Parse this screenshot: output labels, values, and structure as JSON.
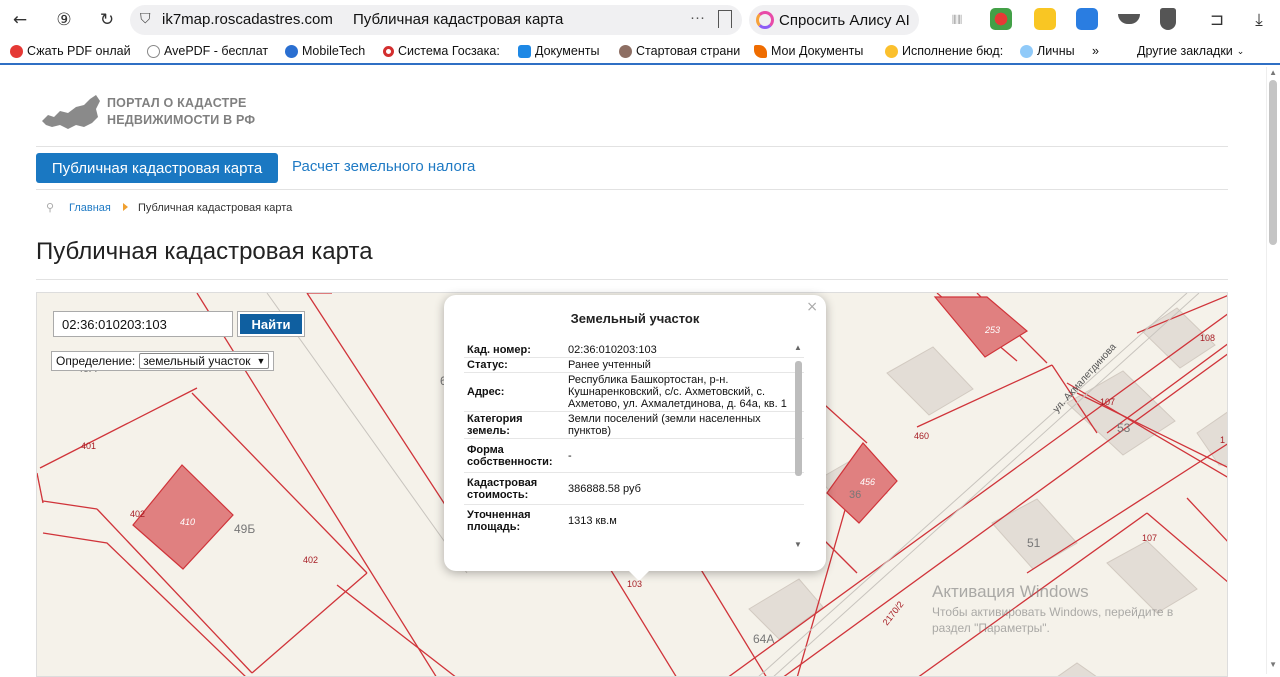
{
  "browser": {
    "url_domain": "ik7map.roscadastres.com",
    "tab_title": "Публичная кадастровая карта",
    "alice_label": "Спросить Алису AI",
    "bookmarks": [
      "Сжать PDF онлай",
      "AvePDF - бесплат",
      "MobileTech",
      "Система Госзака:",
      "Документы",
      "Стартовая страни",
      "Мои Документы",
      "Исполнение бюд:",
      "Личны",
      "»",
      "Другие закладки"
    ]
  },
  "site": {
    "logo_line1": "ПОРТАЛ О КАДАСТРЕ",
    "logo_line2": "НЕДВИЖИМОСТИ В РФ",
    "nav_active": "Публичная кадастровая карта",
    "nav_link": "Расчет земельного налога",
    "breadcrumb_home": "Главная",
    "breadcrumb_current": "Публичная кадастровая карта",
    "page_title": "Публичная кадастровая карта"
  },
  "map": {
    "search_value": "02:36:010203:103",
    "search_button": "Найти",
    "definition_label": "Определение:",
    "definition_value": "земельный участок",
    "labels": {
      "l401": "401",
      "l402a": "402",
      "l410": "410",
      "l49b": "49Б",
      "l402b": "402",
      "l49a": "49А",
      "l253": "253",
      "l108": "108",
      "l107a": "107",
      "l53": "53",
      "l460": "460",
      "l456": "456",
      "l51": "51",
      "l107b": "107",
      "l103": "103",
      "l64a": "64А",
      "l2170": "2170/2",
      "street": "ул. Ахмалетдинова",
      "l1": "1",
      "l6": "6",
      "l36": "36"
    },
    "colors": {
      "background": "#f5f2ea",
      "parcel_line": "#d0343a",
      "parcel_fill": "#e08080",
      "building": "#e3ddd6"
    }
  },
  "popup": {
    "title": "Земельный участок",
    "close": "×",
    "rows": [
      {
        "key": "Кад. номер:",
        "value": "02:36:010203:103"
      },
      {
        "key": "Статус:",
        "value": "Ранее учтенный"
      },
      {
        "key": "Адрес:",
        "value": "Республика Башкортостан, р-н. Кушнаренковский, с/с. Ахметовский, с. Ахметово, ул. Ахмалетдинова, д. 64а, кв. 1"
      },
      {
        "key": "Категория земель:",
        "value": "Земли поселений (земли населенных пунктов)"
      },
      {
        "key": "Форма собственности:",
        "value": "-"
      },
      {
        "key": "Кадастровая стоимость:",
        "value": "386888.58 руб"
      },
      {
        "key": "Уточненная площадь:",
        "value": "1313 кв.м"
      }
    ]
  },
  "windows": {
    "activation_title": "Активация Windows",
    "activation_line1": "Чтобы активировать Windows, перейдите в",
    "activation_line2": "раздел \"Параметры\"."
  }
}
